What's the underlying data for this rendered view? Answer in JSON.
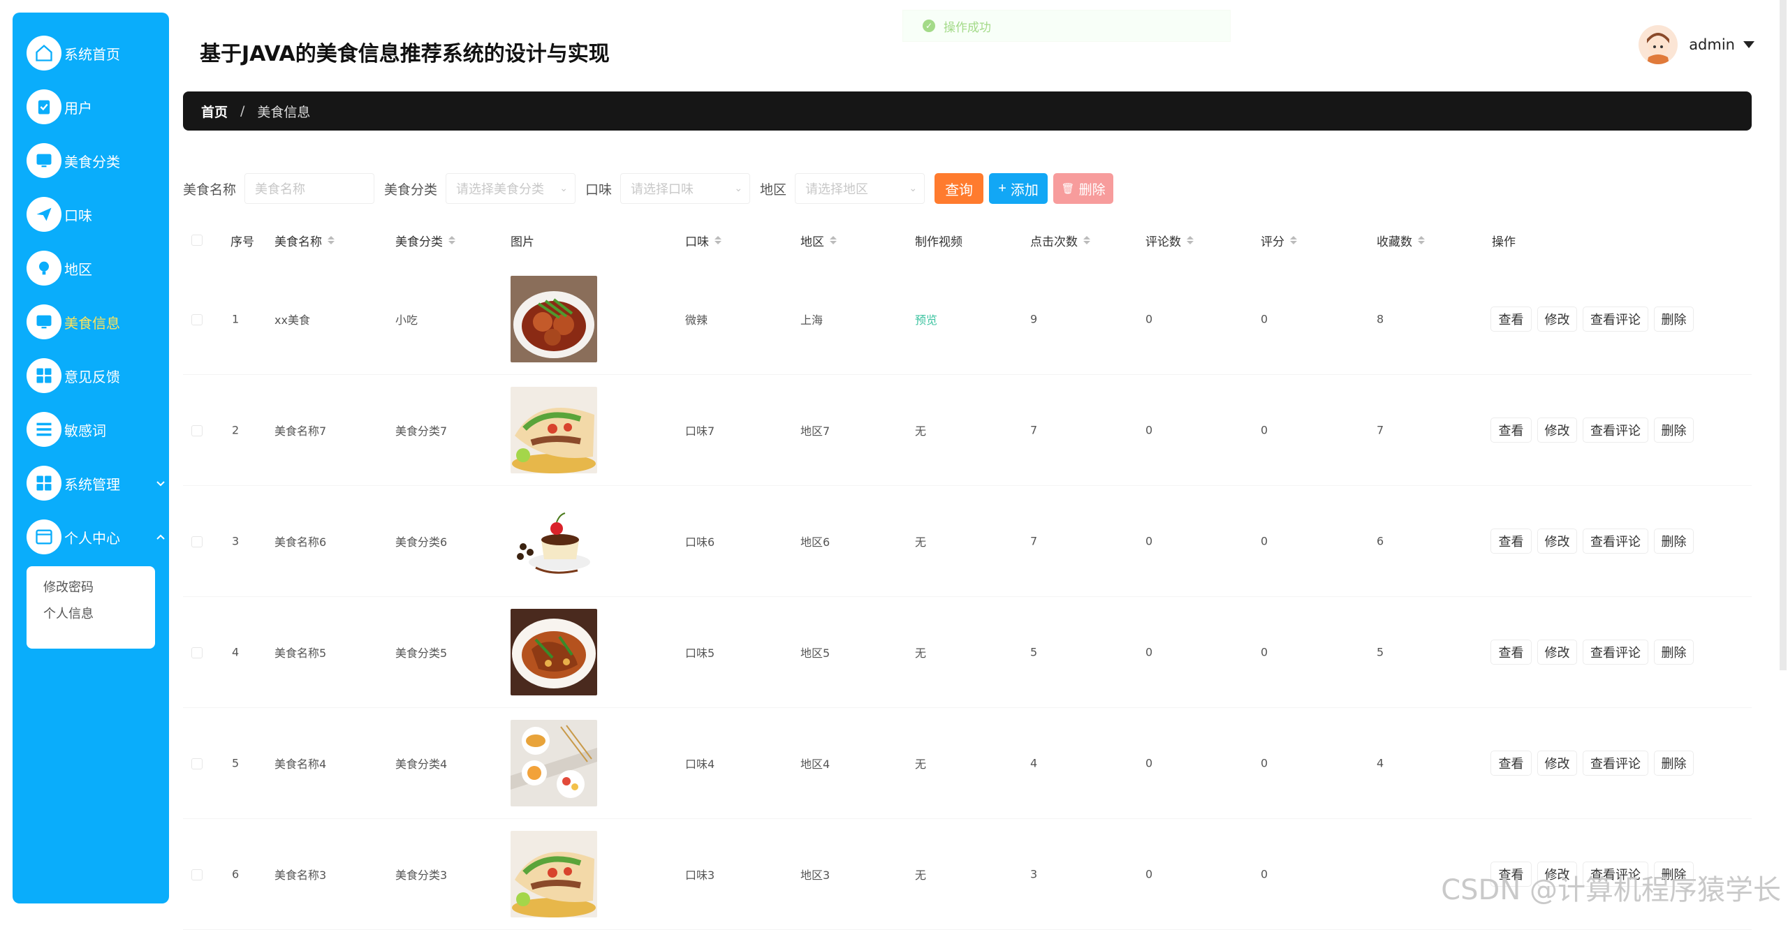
{
  "header": {
    "title": "基于JAVA的美食信息推荐系统的设计与实现",
    "toast": "操作成功",
    "username": "admin"
  },
  "sidebar": {
    "items": [
      {
        "label": "系统首页",
        "icon": "home-icon"
      },
      {
        "label": "用户",
        "icon": "clipboard-icon"
      },
      {
        "label": "美食分类",
        "icon": "monitor-icon"
      },
      {
        "label": "口味",
        "icon": "send-icon"
      },
      {
        "label": "地区",
        "icon": "bulb-icon"
      },
      {
        "label": "美食信息",
        "icon": "monitor-icon",
        "active": true
      },
      {
        "label": "意见反馈",
        "icon": "grid-icon"
      },
      {
        "label": "敏感词",
        "icon": "list-icon"
      },
      {
        "label": "系统管理",
        "icon": "grid-icon"
      },
      {
        "label": "个人中心",
        "icon": "window-icon"
      }
    ],
    "submenu": [
      "修改密码",
      "个人信息"
    ]
  },
  "breadcrumb": {
    "home": "首页",
    "separator": "/",
    "current": "美食信息"
  },
  "search": {
    "name_label": "美食名称",
    "name_placeholder": "美食名称",
    "category_label": "美食分类",
    "category_placeholder": "请选择美食分类",
    "flavor_label": "口味",
    "flavor_placeholder": "请选择口味",
    "region_label": "地区",
    "region_placeholder": "请选择地区",
    "query_label": "查询",
    "add_label": "添加",
    "delete_label": "删除"
  },
  "table": {
    "columns": [
      "序号",
      "美食名称",
      "美食分类",
      "图片",
      "口味",
      "地区",
      "制作视频",
      "点击次数",
      "评论数",
      "评分",
      "收藏数",
      "操作"
    ],
    "rows": [
      {
        "no": "1",
        "name": "xx美食",
        "category": "小吃",
        "flavor": "微辣",
        "region": "上海",
        "video": "预览",
        "clicks": "9",
        "comments": "0",
        "rating": "0",
        "favorites": "8"
      },
      {
        "no": "2",
        "name": "美食名称7",
        "category": "美食分类7",
        "flavor": "口味7",
        "region": "地区7",
        "video": "无",
        "clicks": "7",
        "comments": "0",
        "rating": "0",
        "favorites": "7"
      },
      {
        "no": "3",
        "name": "美食名称6",
        "category": "美食分类6",
        "flavor": "口味6",
        "region": "地区6",
        "video": "无",
        "clicks": "7",
        "comments": "0",
        "rating": "0",
        "favorites": "6"
      },
      {
        "no": "4",
        "name": "美食名称5",
        "category": "美食分类5",
        "flavor": "口味5",
        "region": "地区5",
        "video": "无",
        "clicks": "5",
        "comments": "0",
        "rating": "0",
        "favorites": "5"
      },
      {
        "no": "5",
        "name": "美食名称4",
        "category": "美食分类4",
        "flavor": "口味4",
        "region": "地区4",
        "video": "无",
        "clicks": "4",
        "comments": "0",
        "rating": "0",
        "favorites": "4"
      },
      {
        "no": "6",
        "name": "美食名称3",
        "category": "美食分类3",
        "flavor": "口味3",
        "region": "地区3",
        "video": "无",
        "clicks": "3",
        "comments": "0",
        "rating": "0",
        "favorites": ""
      }
    ],
    "actions": {
      "view": "查看",
      "edit": "修改",
      "view_comments": "查看评论",
      "delete": "删除"
    }
  },
  "watermark": "CSDN @计算机程序猿学长",
  "colors": {
    "sidebar": "#0aadfb",
    "active": "#ffe35a",
    "query": "#ff7b2e",
    "add": "#12a7f5",
    "delete": "#f79c9c",
    "breadcrumb": "#161616"
  }
}
